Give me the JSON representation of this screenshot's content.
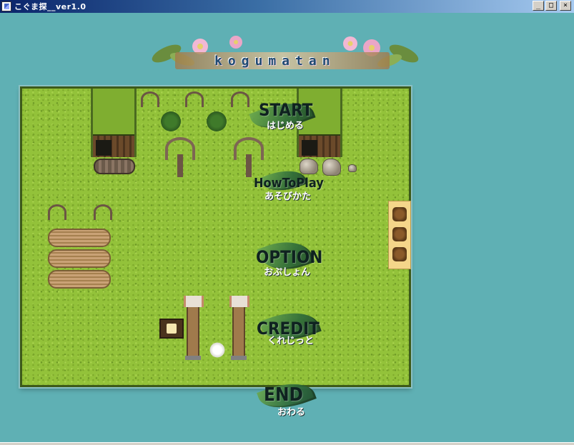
{
  "window": {
    "title": "こぐま探__ver1.0",
    "buttons": {
      "minimize": "_",
      "maximize": "□",
      "close": "×"
    }
  },
  "logo": {
    "word": "kogumatan"
  },
  "menu": {
    "items": [
      {
        "key": "start",
        "label": "START",
        "sublabel": "はじめる"
      },
      {
        "key": "howtoplay",
        "label": "HowToPlay",
        "sublabel": "あそびかた"
      },
      {
        "key": "option",
        "label": "OPTION",
        "sublabel": "おぷしょん"
      },
      {
        "key": "credit",
        "label": "CREDIT",
        "sublabel": "くれじっと"
      },
      {
        "key": "end",
        "label": "END",
        "sublabel": "おわる"
      }
    ]
  },
  "icons": {
    "app": "app-icon",
    "sign": "beer-sign-icon",
    "leaf": "leaf-icon"
  },
  "colors": {
    "background": "#5fb0b4",
    "grass": "#93c23a",
    "menu_text": "#0f2220",
    "sub_text": "#ffffff"
  }
}
